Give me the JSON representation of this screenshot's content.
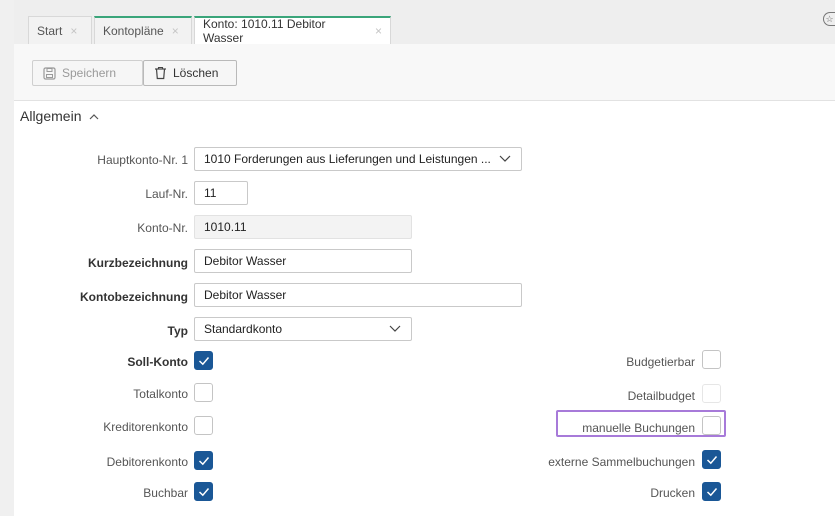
{
  "tabs": [
    {
      "label": "Start",
      "close": "×"
    },
    {
      "label": "Kontopläne",
      "close": "×"
    },
    {
      "label": "Konto: 1010.11 Debitor Wasser",
      "close": "×"
    }
  ],
  "toolbar": {
    "save_label": "Speichern",
    "delete_label": "Löschen"
  },
  "section": {
    "title": "Allgemein"
  },
  "form": {
    "hauptkonto": {
      "label": "Hauptkonto-Nr. 1",
      "value": "1010 Forderungen aus Lieferungen und Leistungen ..."
    },
    "lauf": {
      "label": "Lauf-Nr.",
      "value": "11"
    },
    "konto": {
      "label": "Konto-Nr.",
      "value": "1010.11"
    },
    "kurz": {
      "label": "Kurzbezeichnung",
      "value": "Debitor Wasser"
    },
    "kontobez": {
      "label": "Kontobezeichnung",
      "value": "Debitor Wasser"
    },
    "typ": {
      "label": "Typ",
      "value": "Standardkonto"
    }
  },
  "checkboxes_left": [
    {
      "label": "Soll-Konto",
      "checked": true
    },
    {
      "label": "Totalkonto",
      "checked": false
    },
    {
      "label": "Kreditorenkonto",
      "checked": false
    },
    {
      "label": "Debitorenkonto",
      "checked": true
    },
    {
      "label": "Buchbar",
      "checked": true
    }
  ],
  "checkboxes_right": [
    {
      "label": "Budgetierbar",
      "checked": false
    },
    {
      "label": "Detailbudget",
      "checked": false
    },
    {
      "label": "manuelle Buchungen",
      "checked": false
    },
    {
      "label": "externe Sammelbuchungen",
      "checked": true
    },
    {
      "label": "Drucken",
      "checked": true
    }
  ],
  "colors": {
    "accent": "#1a5796",
    "tab_active_border": "#3aa57a",
    "highlight": "#a77ad9"
  }
}
